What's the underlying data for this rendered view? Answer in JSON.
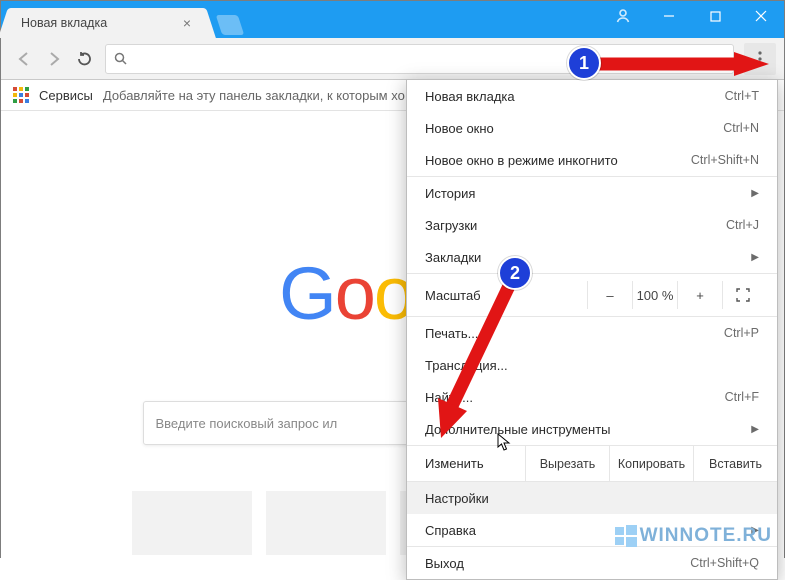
{
  "window": {
    "tab_title": "Новая вкладка"
  },
  "bookmarks_bar": {
    "services": "Сервисы",
    "hint": "Добавляйте на эту панель закладки, к которым хо"
  },
  "search_placeholder": "Введите поисковый запрос ил",
  "menu": {
    "new_tab": {
      "label": "Новая вкладка",
      "accel": "Ctrl+T"
    },
    "new_window": {
      "label": "Новое окно",
      "accel": "Ctrl+N"
    },
    "new_incognito": {
      "label": "Новое окно в режиме инкогнито",
      "accel": "Ctrl+Shift+N"
    },
    "history": {
      "label": "История"
    },
    "downloads": {
      "label": "Загрузки",
      "accel": "Ctrl+J"
    },
    "bookmarks": {
      "label": "Закладки"
    },
    "zoom": {
      "label": "Масштаб",
      "minus": "–",
      "value": "100 %",
      "plus": "+"
    },
    "print": {
      "label": "Печать...",
      "accel": "Ctrl+P"
    },
    "cast": {
      "label": "Трансляция..."
    },
    "find": {
      "label": "Найти...",
      "accel": "Ctrl+F"
    },
    "more_tools": {
      "label": "Дополнительные инструменты"
    },
    "edit": {
      "label": "Изменить",
      "cut": "Вырезать",
      "copy": "Копировать",
      "paste": "Вставить"
    },
    "settings": {
      "label": "Настройки"
    },
    "help": {
      "label": "Справка"
    },
    "exit": {
      "label": "Выход",
      "accel": "Ctrl+Shift+Q"
    }
  },
  "annotations": {
    "badge1": "1",
    "badge2": "2"
  },
  "watermark": "WINNOTE.RU"
}
